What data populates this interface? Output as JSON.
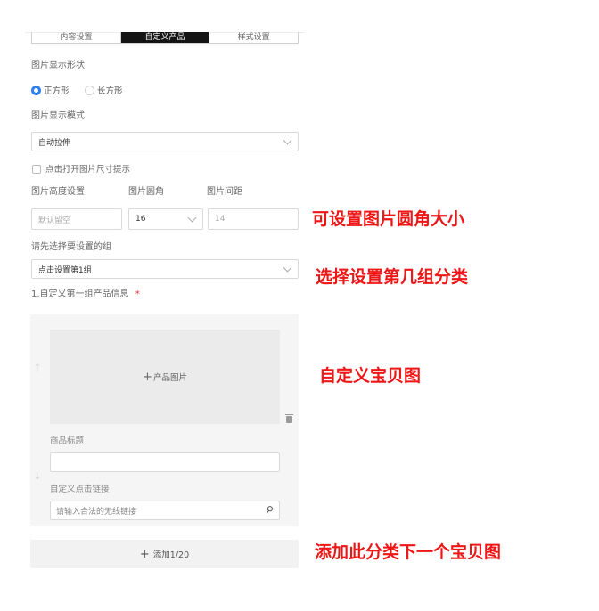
{
  "tabs": [
    {
      "label": "内容设置",
      "active": false
    },
    {
      "label": "自定义产品",
      "active": true
    },
    {
      "label": "样式设置",
      "active": false
    }
  ],
  "image_shape": {
    "label": "图片显示形状",
    "options": [
      {
        "label": "正方形",
        "selected": true
      },
      {
        "label": "长方形",
        "selected": false
      }
    ]
  },
  "image_mode": {
    "label": "图片显示模式",
    "value": "自动拉伸"
  },
  "size_hint": {
    "label": "点击打开图片尺寸提示",
    "checked": false
  },
  "dimensions": {
    "height_label": "图片高度设置",
    "radius_label": "图片圆角",
    "gap_label": "图片间距",
    "height_placeholder": "默认留空",
    "radius_value": "16",
    "gap_value": "14"
  },
  "group": {
    "label": "请先选择要设置的组",
    "value": "点击设置第1组"
  },
  "product": {
    "section_title": "1.自定义第一组产品信息",
    "required_mark": "*",
    "image_plus": "+",
    "image_label": "产品图片",
    "title_label": "商品标题",
    "title_value": "",
    "link_label": "自定义点击链接",
    "link_placeholder": "请输入合法的无线链接"
  },
  "add_button": {
    "plus": "+",
    "label": "添加1/20"
  },
  "annotations": [
    "可设置图片圆角大小",
    "选择设置第几组分类",
    "自定义宝贝图",
    "添加此分类下一个宝贝图"
  ],
  "colors": {
    "accent": "#2f7ff5",
    "annotation": "#ee1616",
    "active_tab": "#141414"
  }
}
